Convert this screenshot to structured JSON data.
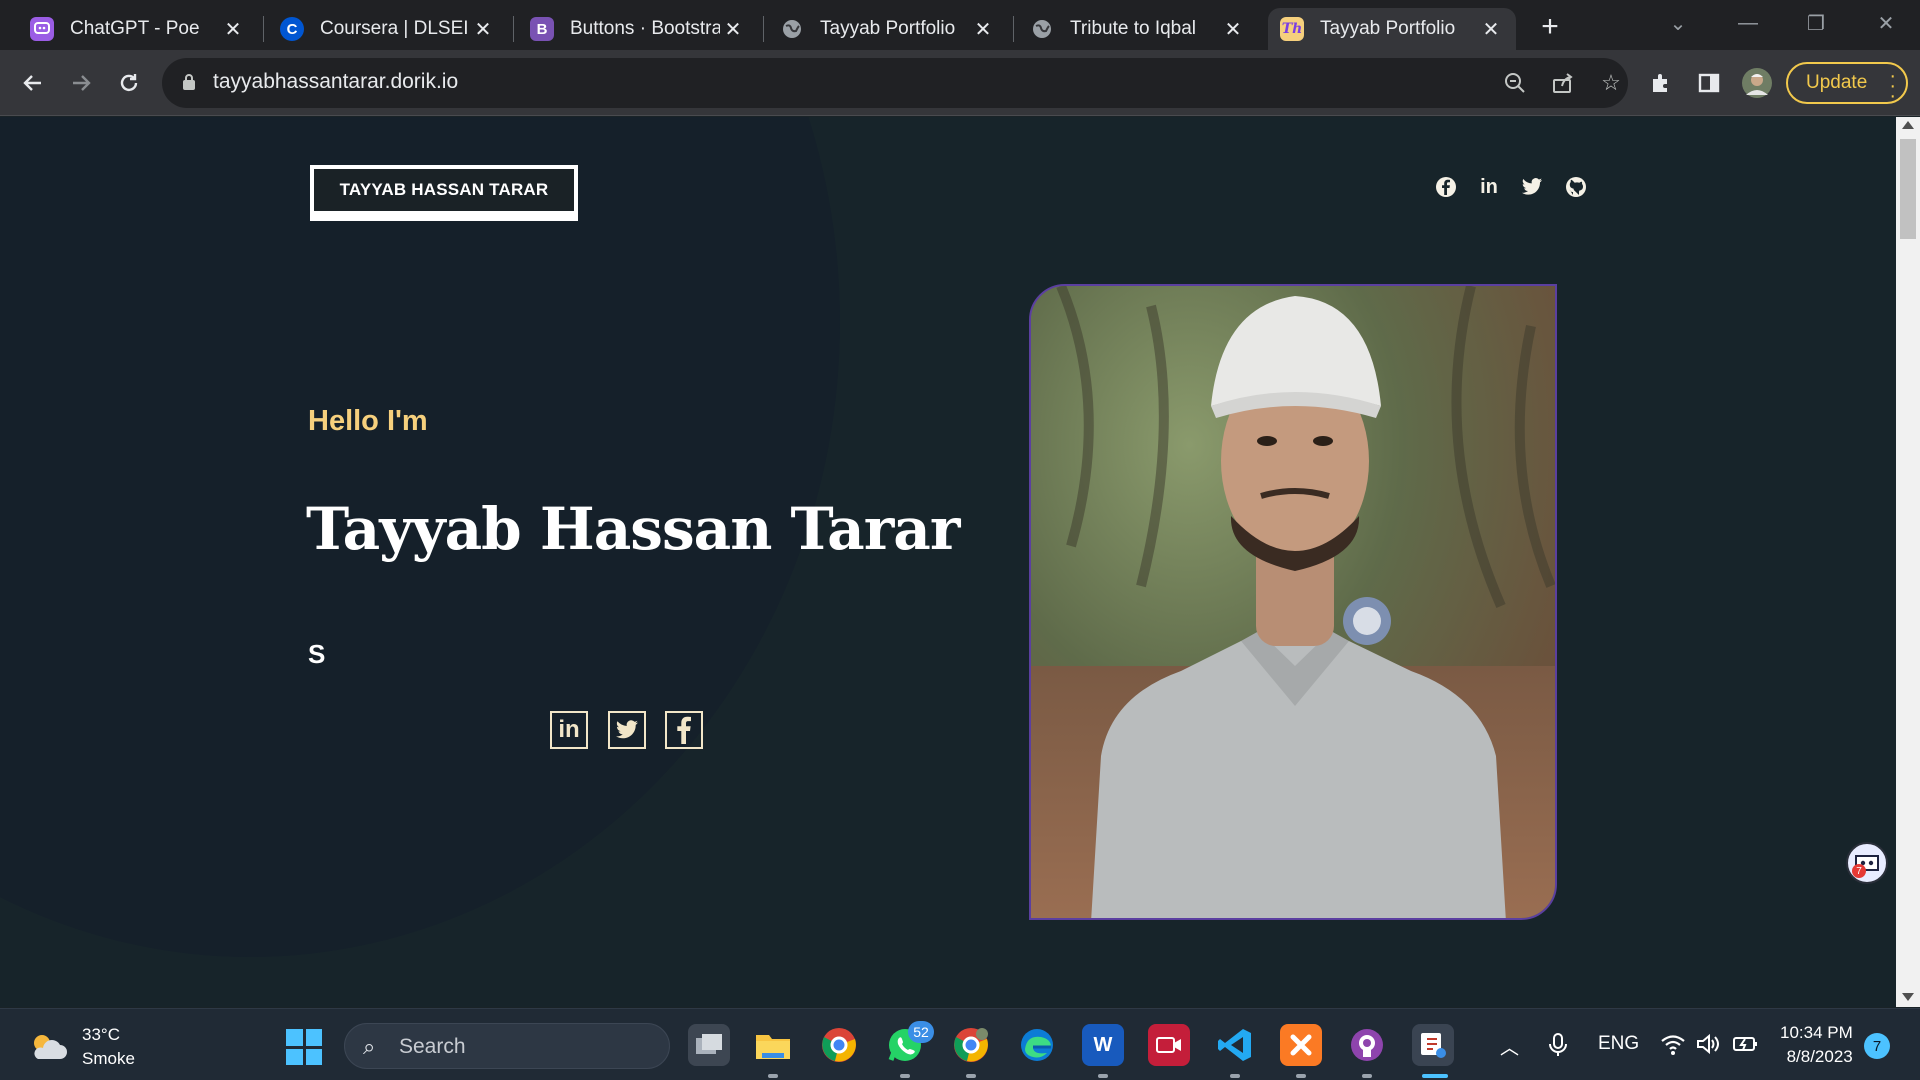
{
  "browser": {
    "tabs": [
      {
        "title": "ChatGPT - Poe",
        "icon": "poe-icon",
        "color": "#9b5de5",
        "glyph": ""
      },
      {
        "title": "Coursera | DLSEI Ph",
        "icon": "coursera-icon",
        "color": "#0056d2",
        "glyph": "C"
      },
      {
        "title": "Buttons · Bootstrap",
        "icon": "bootstrap-icon",
        "color": "#7952b3",
        "glyph": "B"
      },
      {
        "title": "Tayyab Portfolio",
        "icon": "globe-icon",
        "color": "#5f6368",
        "glyph": ""
      },
      {
        "title": "Tribute to Iqbal",
        "icon": "globe-icon",
        "color": "#5f6368",
        "glyph": ""
      },
      {
        "title": "Tayyab Portfolio",
        "icon": "th-favicon-icon",
        "color": "#f6d07d",
        "glyph": "Th"
      }
    ],
    "url": "tayyabhassantarar.dorik.io",
    "update_label": "Update"
  },
  "site": {
    "logo_text": "TAYYAB HASSAN TARAR",
    "greeting": "Hello I'm",
    "name": "Tayyab Hassan Tarar",
    "typed_text": "S",
    "header_social": [
      "facebook",
      "linkedin",
      "twitter",
      "github"
    ],
    "hero_social": [
      "linkedin",
      "twitter",
      "facebook"
    ]
  },
  "taskbar": {
    "temperature": "33°C",
    "condition": "Smoke",
    "search_placeholder": "Search",
    "whatsapp_badge": "52",
    "language": "ENG",
    "time": "10:34 PM",
    "date": "8/8/2023",
    "notifications": "7",
    "chat_badge": "7"
  }
}
